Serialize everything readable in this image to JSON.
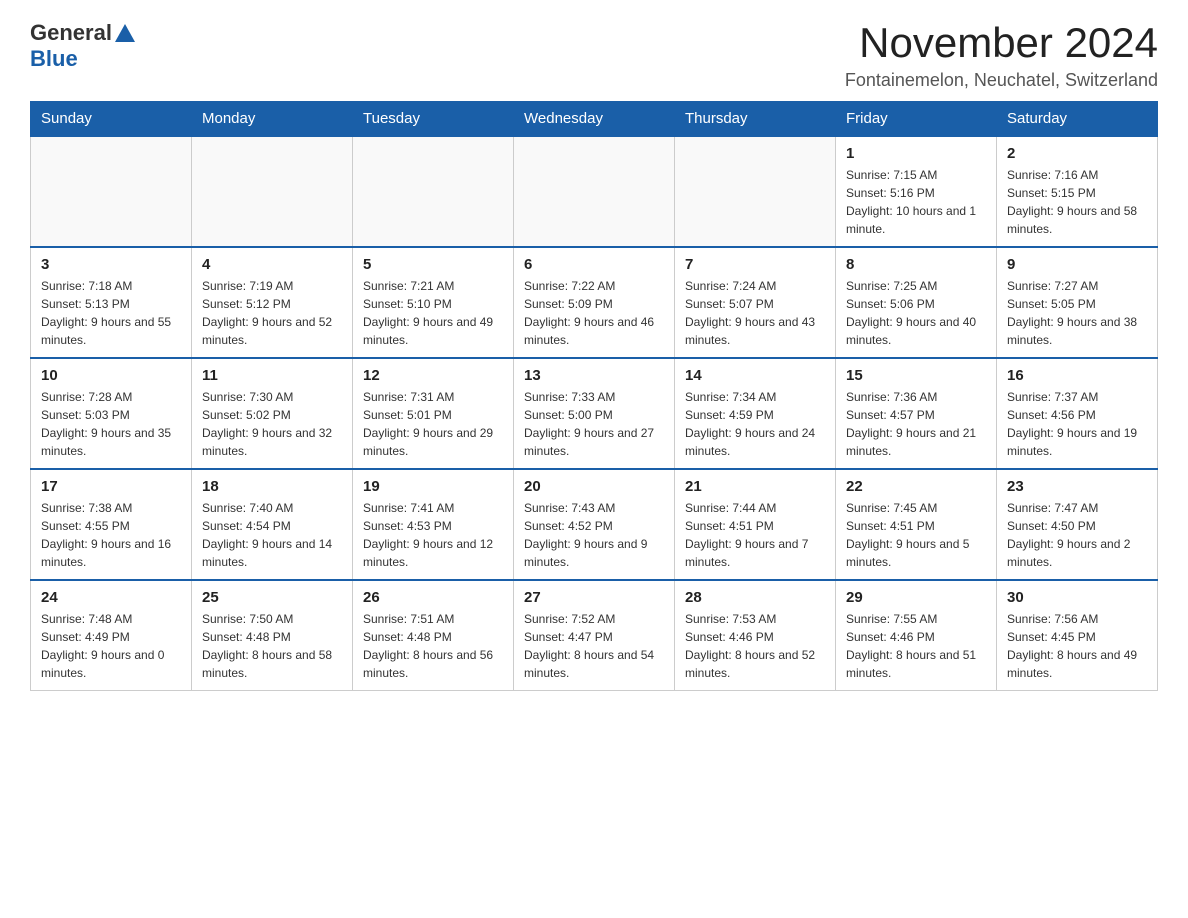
{
  "header": {
    "logo_general": "General",
    "logo_blue": "Blue",
    "main_title": "November 2024",
    "subtitle": "Fontainemelon, Neuchatel, Switzerland"
  },
  "days_of_week": [
    "Sunday",
    "Monday",
    "Tuesday",
    "Wednesday",
    "Thursday",
    "Friday",
    "Saturday"
  ],
  "weeks": [
    [
      {
        "day": "",
        "info": ""
      },
      {
        "day": "",
        "info": ""
      },
      {
        "day": "",
        "info": ""
      },
      {
        "day": "",
        "info": ""
      },
      {
        "day": "",
        "info": ""
      },
      {
        "day": "1",
        "info": "Sunrise: 7:15 AM\nSunset: 5:16 PM\nDaylight: 10 hours and 1 minute."
      },
      {
        "day": "2",
        "info": "Sunrise: 7:16 AM\nSunset: 5:15 PM\nDaylight: 9 hours and 58 minutes."
      }
    ],
    [
      {
        "day": "3",
        "info": "Sunrise: 7:18 AM\nSunset: 5:13 PM\nDaylight: 9 hours and 55 minutes."
      },
      {
        "day": "4",
        "info": "Sunrise: 7:19 AM\nSunset: 5:12 PM\nDaylight: 9 hours and 52 minutes."
      },
      {
        "day": "5",
        "info": "Sunrise: 7:21 AM\nSunset: 5:10 PM\nDaylight: 9 hours and 49 minutes."
      },
      {
        "day": "6",
        "info": "Sunrise: 7:22 AM\nSunset: 5:09 PM\nDaylight: 9 hours and 46 minutes."
      },
      {
        "day": "7",
        "info": "Sunrise: 7:24 AM\nSunset: 5:07 PM\nDaylight: 9 hours and 43 minutes."
      },
      {
        "day": "8",
        "info": "Sunrise: 7:25 AM\nSunset: 5:06 PM\nDaylight: 9 hours and 40 minutes."
      },
      {
        "day": "9",
        "info": "Sunrise: 7:27 AM\nSunset: 5:05 PM\nDaylight: 9 hours and 38 minutes."
      }
    ],
    [
      {
        "day": "10",
        "info": "Sunrise: 7:28 AM\nSunset: 5:03 PM\nDaylight: 9 hours and 35 minutes."
      },
      {
        "day": "11",
        "info": "Sunrise: 7:30 AM\nSunset: 5:02 PM\nDaylight: 9 hours and 32 minutes."
      },
      {
        "day": "12",
        "info": "Sunrise: 7:31 AM\nSunset: 5:01 PM\nDaylight: 9 hours and 29 minutes."
      },
      {
        "day": "13",
        "info": "Sunrise: 7:33 AM\nSunset: 5:00 PM\nDaylight: 9 hours and 27 minutes."
      },
      {
        "day": "14",
        "info": "Sunrise: 7:34 AM\nSunset: 4:59 PM\nDaylight: 9 hours and 24 minutes."
      },
      {
        "day": "15",
        "info": "Sunrise: 7:36 AM\nSunset: 4:57 PM\nDaylight: 9 hours and 21 minutes."
      },
      {
        "day": "16",
        "info": "Sunrise: 7:37 AM\nSunset: 4:56 PM\nDaylight: 9 hours and 19 minutes."
      }
    ],
    [
      {
        "day": "17",
        "info": "Sunrise: 7:38 AM\nSunset: 4:55 PM\nDaylight: 9 hours and 16 minutes."
      },
      {
        "day": "18",
        "info": "Sunrise: 7:40 AM\nSunset: 4:54 PM\nDaylight: 9 hours and 14 minutes."
      },
      {
        "day": "19",
        "info": "Sunrise: 7:41 AM\nSunset: 4:53 PM\nDaylight: 9 hours and 12 minutes."
      },
      {
        "day": "20",
        "info": "Sunrise: 7:43 AM\nSunset: 4:52 PM\nDaylight: 9 hours and 9 minutes."
      },
      {
        "day": "21",
        "info": "Sunrise: 7:44 AM\nSunset: 4:51 PM\nDaylight: 9 hours and 7 minutes."
      },
      {
        "day": "22",
        "info": "Sunrise: 7:45 AM\nSunset: 4:51 PM\nDaylight: 9 hours and 5 minutes."
      },
      {
        "day": "23",
        "info": "Sunrise: 7:47 AM\nSunset: 4:50 PM\nDaylight: 9 hours and 2 minutes."
      }
    ],
    [
      {
        "day": "24",
        "info": "Sunrise: 7:48 AM\nSunset: 4:49 PM\nDaylight: 9 hours and 0 minutes."
      },
      {
        "day": "25",
        "info": "Sunrise: 7:50 AM\nSunset: 4:48 PM\nDaylight: 8 hours and 58 minutes."
      },
      {
        "day": "26",
        "info": "Sunrise: 7:51 AM\nSunset: 4:48 PM\nDaylight: 8 hours and 56 minutes."
      },
      {
        "day": "27",
        "info": "Sunrise: 7:52 AM\nSunset: 4:47 PM\nDaylight: 8 hours and 54 minutes."
      },
      {
        "day": "28",
        "info": "Sunrise: 7:53 AM\nSunset: 4:46 PM\nDaylight: 8 hours and 52 minutes."
      },
      {
        "day": "29",
        "info": "Sunrise: 7:55 AM\nSunset: 4:46 PM\nDaylight: 8 hours and 51 minutes."
      },
      {
        "day": "30",
        "info": "Sunrise: 7:56 AM\nSunset: 4:45 PM\nDaylight: 8 hours and 49 minutes."
      }
    ]
  ]
}
